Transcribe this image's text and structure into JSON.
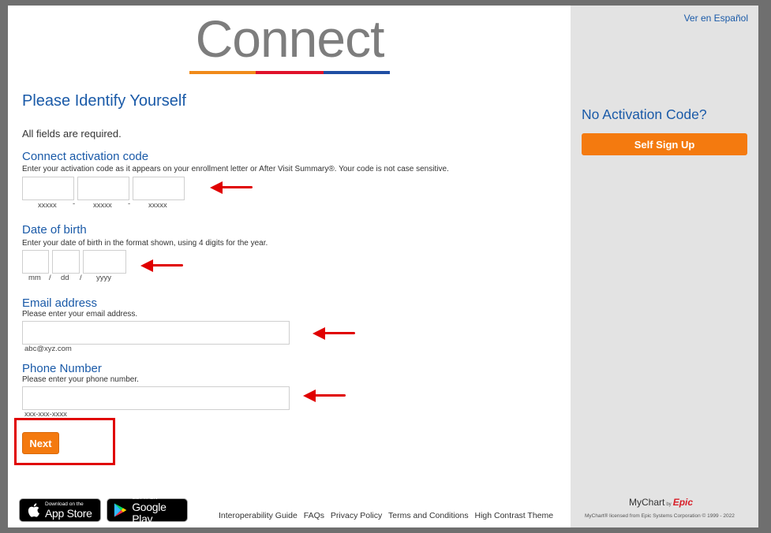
{
  "logo": {
    "text": "Connect"
  },
  "page_title": "Please Identify Yourself",
  "required_note": "All fields are required.",
  "activation": {
    "label": "Connect activation code",
    "help": "Enter your activation code as it appears on your enrollment letter or After Visit Summary®. Your code is not case sensitive.",
    "hints": [
      "xxxxx",
      "xxxxx",
      "xxxxx"
    ],
    "separator": "-"
  },
  "dob": {
    "label": "Date of birth",
    "help": "Enter your date of birth in the format shown, using 4 digits for the year.",
    "hints": [
      "mm",
      "dd",
      "yyyy"
    ],
    "separator": "/"
  },
  "email": {
    "label": "Email address",
    "help": "Please enter your email address.",
    "hint": "abc@xyz.com"
  },
  "phone": {
    "label": "Phone Number",
    "help": "Please enter your phone number.",
    "hint": "xxx-xxx-xxxx"
  },
  "next_label": "Next",
  "app_store": {
    "small": "Download on the",
    "big": "App Store"
  },
  "google_play": {
    "small": "GET IT ON",
    "big": "Google Play"
  },
  "footer_links": [
    "Interoperability Guide",
    "FAQs",
    "Privacy Policy",
    "Terms and Conditions",
    "High Contrast Theme"
  ],
  "sidebar": {
    "lang_link": "Ver en Español",
    "no_activation": "No Activation Code?",
    "signup_label": "Self Sign Up",
    "mychart": "MyChart",
    "by": "by",
    "epic": "Epic",
    "license": "MyChart® licensed from Epic Systems Corporation © 1999 - 2022"
  },
  "colors": {
    "accent_orange": "#f47a0f",
    "link_blue": "#1a5aa8",
    "arrow_red": "#e00000"
  },
  "icons": {
    "apple": "apple-icon",
    "play": "google-play-icon"
  }
}
